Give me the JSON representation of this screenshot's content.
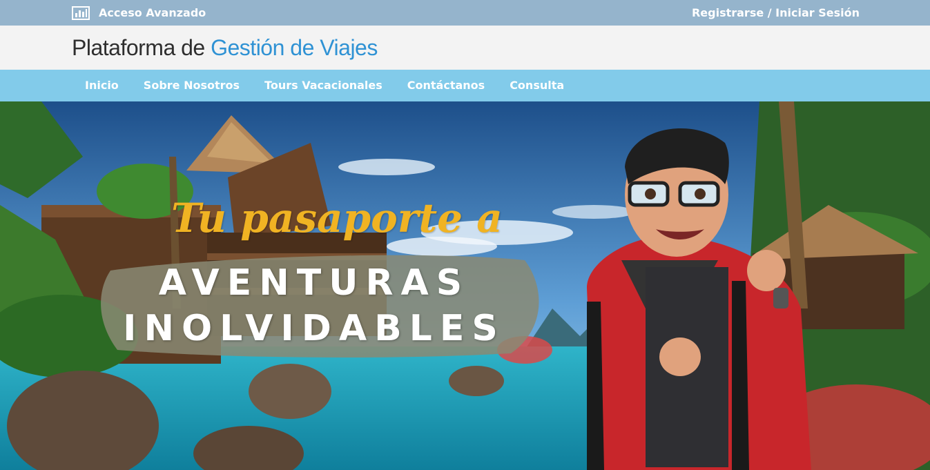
{
  "topbar": {
    "admin_label": "Acceso Avanzado",
    "admin_icon": "bar-chart-icon",
    "auth_link": "Registrarse / Iniciar Sesión"
  },
  "brand": {
    "part1": "Plataforma de ",
    "part2": "Gestión de Viajes"
  },
  "nav": {
    "items": [
      {
        "label": "Inicio"
      },
      {
        "label": "Sobre Nosotros"
      },
      {
        "label": "Tours Vacacionales"
      },
      {
        "label": "Contáctanos"
      },
      {
        "label": "Consulta"
      }
    ]
  },
  "hero": {
    "tagline": "Tu pasaporte a",
    "line1": "AVENTURAS",
    "line2": "INOLVIDABLES"
  },
  "colors": {
    "topbar": "#95b4cc",
    "brandbar": "#f3f3f3",
    "brand_accent": "#2f92d4",
    "navbar": "#82cbea",
    "tagline": "#f0b323"
  }
}
